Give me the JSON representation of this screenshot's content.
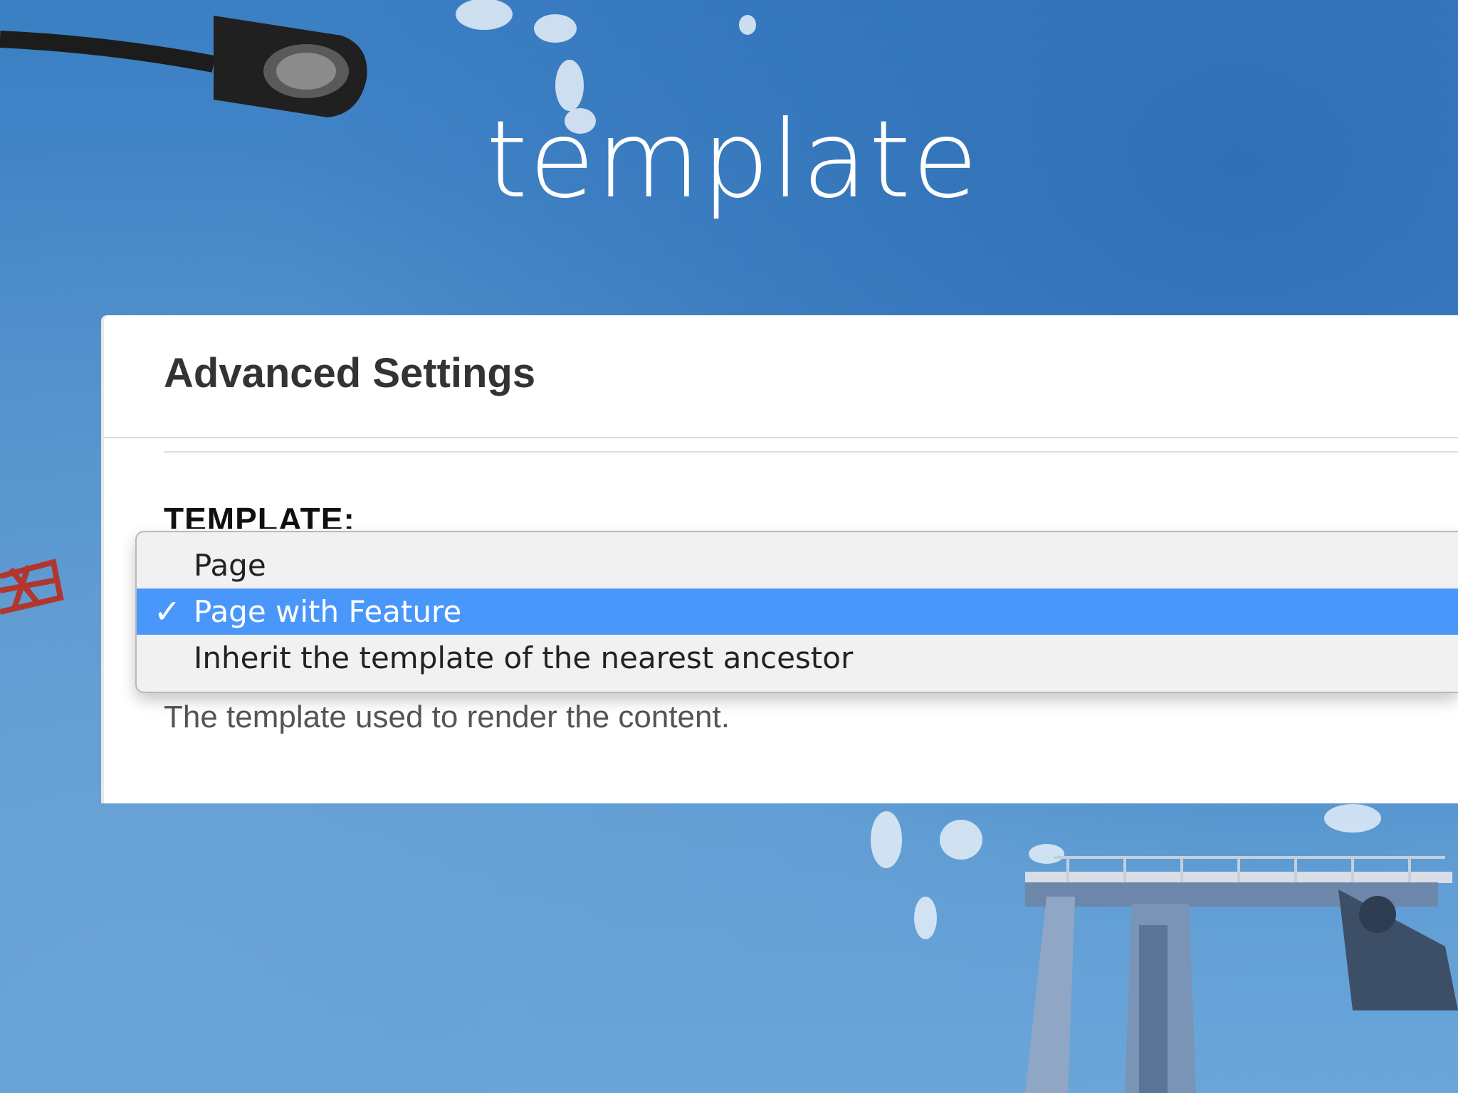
{
  "slide": {
    "title": "template"
  },
  "panel": {
    "title": "Advanced Settings",
    "field_label": "TEMPLATE:",
    "help_text": "The template used to render the content."
  },
  "dropdown": {
    "selected_index": 1,
    "check_glyph": "✓",
    "selection_color": "#4a97fb",
    "options": [
      {
        "label": "Page"
      },
      {
        "label": "Page with Feature"
      },
      {
        "label": "Inherit the template of the nearest ancestor"
      }
    ]
  },
  "background": {
    "description_icons": [
      "street-lamp-icon",
      "crane-icon",
      "gantry-structure-icon"
    ],
    "sky_color": "#4f8fcb"
  }
}
